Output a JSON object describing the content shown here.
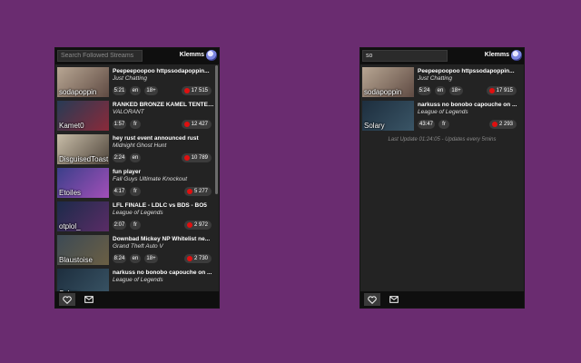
{
  "left": {
    "search": {
      "placeholder": "Search Followed Streams",
      "value": ""
    },
    "user": {
      "name": "Klemms"
    },
    "streams": [
      {
        "channel": "sodapoppin",
        "title": "Peepeepoopoo httpssodapoppin...",
        "game": "Just Chatting",
        "uptime": "5:21",
        "tags": [
          "en",
          "18+"
        ],
        "viewers": "17 515",
        "thumb_colors": [
          "#b8a693",
          "#5f4b43"
        ]
      },
      {
        "channel": "Kamet0",
        "title": "RANKED BRONZE KAMEL TENTE ...",
        "game": "VALORANT",
        "uptime": "1:57",
        "tags": [
          "fr"
        ],
        "viewers": "12 427",
        "thumb_colors": [
          "#273b55",
          "#8a2a3a"
        ]
      },
      {
        "channel": "DisguisedToast",
        "title": "hey rust event announced rust",
        "game": "Midnight Ghost Hunt",
        "uptime": "2:24",
        "tags": [
          "en"
        ],
        "viewers": "10 789",
        "thumb_colors": [
          "#c8bda8",
          "#50463c"
        ]
      },
      {
        "channel": "Etoiles",
        "title": "fun player",
        "game": "Fall Guys Ultimate Knockout",
        "uptime": "4:17",
        "tags": [
          "fr"
        ],
        "viewers": "5 277",
        "thumb_colors": [
          "#3b3f8a",
          "#a24fb8"
        ]
      },
      {
        "channel": "otplol_",
        "title": "LFL FINALE - LDLC vs BDS - BO5",
        "game": "League of Legends",
        "uptime": "2:07",
        "tags": [
          "fr"
        ],
        "viewers": "2 972",
        "thumb_colors": [
          "#1c2b4a",
          "#5a2c66"
        ]
      },
      {
        "channel": "Blaustoise",
        "title": "Downbad Mickey NP Whitelist ne...",
        "game": "Grand Theft Auto V",
        "uptime": "8:24",
        "tags": [
          "en",
          "18+"
        ],
        "viewers": "2 730",
        "thumb_colors": [
          "#3c4a55",
          "#6b5f44"
        ]
      },
      {
        "channel": "Solary",
        "title": "narkuss no bonobo capouche on ...",
        "game": "League of Legends",
        "uptime": "",
        "tags": [],
        "viewers": "",
        "thumb_colors": [
          "#1d2e3e",
          "#3a5566"
        ]
      }
    ]
  },
  "right": {
    "search": {
      "placeholder": "Search Followed Streams",
      "value": "so"
    },
    "user": {
      "name": "Klemms"
    },
    "streams": [
      {
        "channel": "sodapoppin",
        "title": "Peepeepoopoo httpssodapoppin...",
        "game": "Just Chatting",
        "uptime": "5:24",
        "tags": [
          "en",
          "18+"
        ],
        "viewers": "17 915",
        "thumb_colors": [
          "#b8a693",
          "#5f4b43"
        ]
      },
      {
        "channel": "Solary",
        "title": "narkuss no bonobo capouche on ...",
        "game": "League of Legends",
        "uptime": "43:47",
        "tags": [
          "fr"
        ],
        "viewers": "2 293",
        "thumb_colors": [
          "#1d2e3e",
          "#3a5566"
        ]
      }
    ],
    "update_text": "Last Update 01:24:05 - Updates every 5mins"
  },
  "icons": {
    "favorites": "heart-icon",
    "messages": "mail-icon"
  },
  "colors": {
    "background": "#6a2c70",
    "panel": "#232323",
    "bar": "#0f0f0f",
    "live_dot": "#e01010"
  }
}
